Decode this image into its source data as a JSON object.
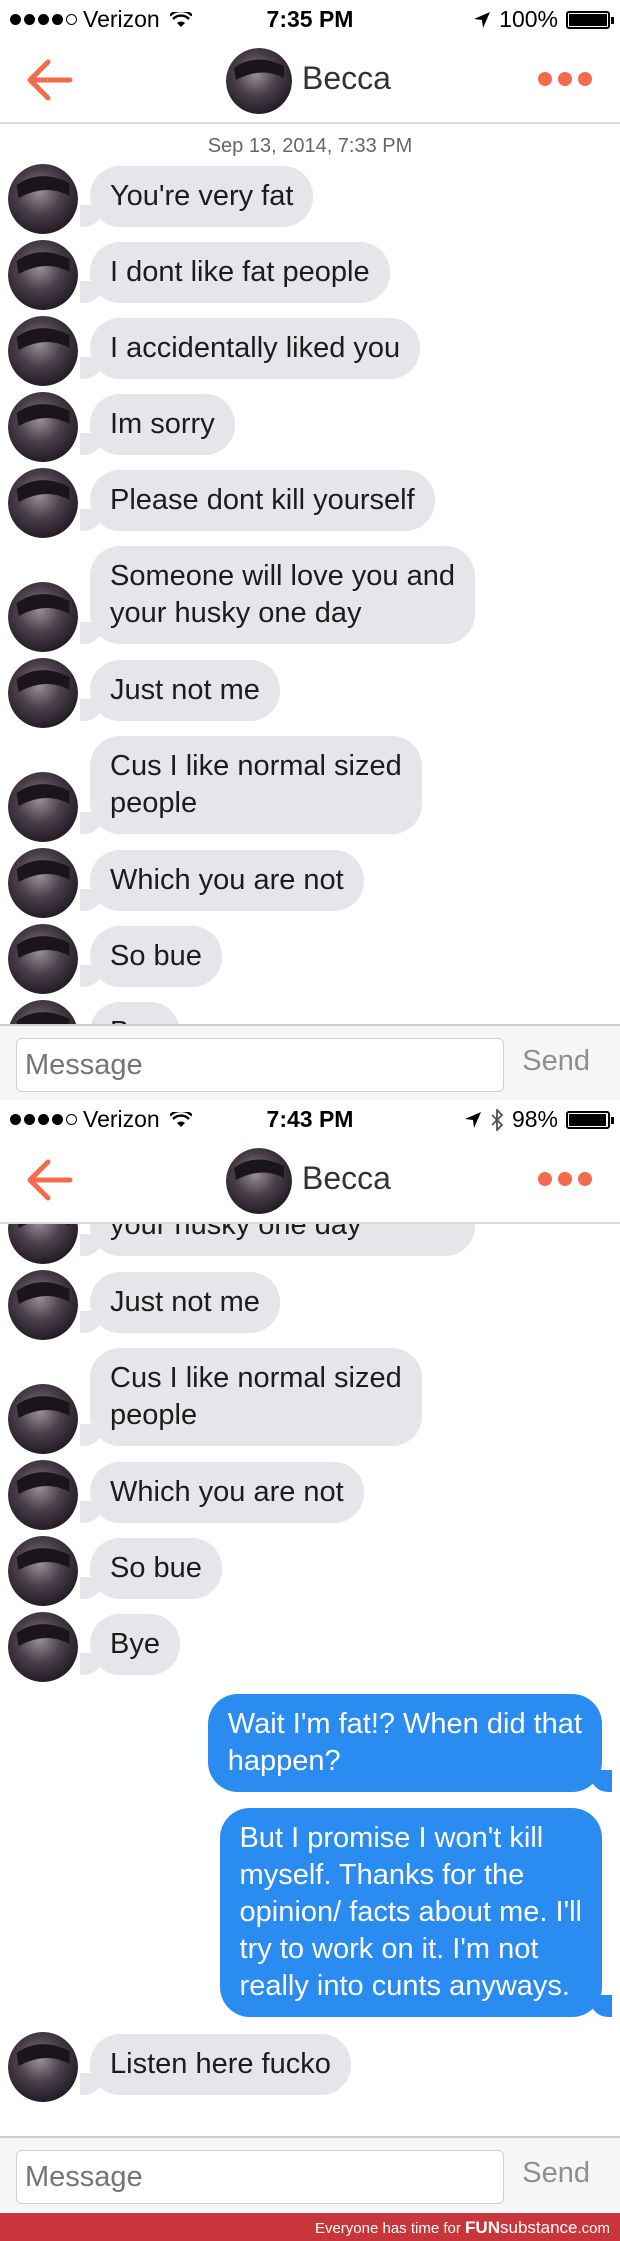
{
  "colors": {
    "accent": "#f26b4d",
    "incoming_bubble": "#e5e5ea",
    "outgoing_bubble": "#2a8cf0",
    "footer": "#c8353a"
  },
  "screens": [
    {
      "status": {
        "carrier": "Verizon",
        "time": "7:35 PM",
        "battery": "100%",
        "battery_level": 1.0,
        "icons": [
          "location-arrow-icon"
        ]
      },
      "nav": {
        "name": "Becca"
      },
      "date": "Sep 13, 2014, 7:33 PM",
      "messages": [
        {
          "from": "them",
          "text": "You're very fat"
        },
        {
          "from": "them",
          "text": "I dont like fat people"
        },
        {
          "from": "them",
          "text": "I accidentally liked you"
        },
        {
          "from": "them",
          "text": "Im sorry"
        },
        {
          "from": "them",
          "text": "Please dont kill yourself"
        },
        {
          "from": "them",
          "text": "Someone will love you and\nyour husky one day"
        },
        {
          "from": "them",
          "text": "Just not me"
        },
        {
          "from": "them",
          "text": "Cus I like normal sized\npeople"
        },
        {
          "from": "them",
          "text": "Which you are not"
        },
        {
          "from": "them",
          "text": "So bue"
        },
        {
          "from": "them",
          "text": "Bye"
        }
      ],
      "composer": {
        "placeholder": "Message",
        "send": "Send"
      }
    },
    {
      "status": {
        "carrier": "Verizon",
        "time": "7:43 PM",
        "battery": "98%",
        "battery_level": 0.98,
        "icons": [
          "location-arrow-icon",
          "bluetooth-icon"
        ]
      },
      "nav": {
        "name": "Becca"
      },
      "messages": [
        {
          "from": "them",
          "text": "Someone will love you and\nyour husky one day"
        },
        {
          "from": "them",
          "text": "Just not me"
        },
        {
          "from": "them",
          "text": "Cus I like normal sized\npeople"
        },
        {
          "from": "them",
          "text": "Which you are not"
        },
        {
          "from": "them",
          "text": "So bue"
        },
        {
          "from": "them",
          "text": "Bye"
        },
        {
          "from": "me",
          "text": "Wait I'm fat!? When did that\nhappen?"
        },
        {
          "from": "me",
          "text": "But I promise I won't kill\nmyself. Thanks for the\nopinion/ facts about me. I'll\ntry to work on it. I'm not\nreally into cunts anyways."
        },
        {
          "from": "them",
          "text": "Listen here fucko"
        }
      ],
      "composer": {
        "placeholder": "Message",
        "send": "Send"
      }
    }
  ],
  "footer": {
    "text": "Everyone has time for",
    "brand_a": "FUN",
    "brand_b": "substance",
    "brand_c": ".com"
  }
}
